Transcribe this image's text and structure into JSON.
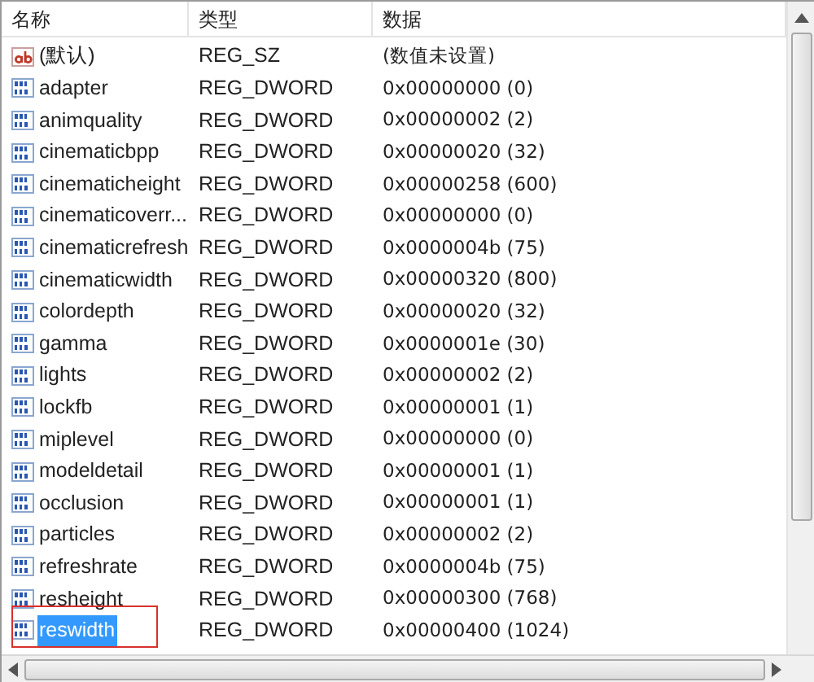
{
  "columns": [
    "名称",
    "类型",
    "数据"
  ],
  "rows": [
    {
      "kind": "string",
      "name": "(默认)",
      "type": "REG_SZ",
      "data": "(数值未设置)",
      "selected": false,
      "circled": false
    },
    {
      "kind": "dword",
      "name": "adapter",
      "type": "REG_DWORD",
      "data": "0x00000000 (0)",
      "selected": false,
      "circled": false
    },
    {
      "kind": "dword",
      "name": "animquality",
      "type": "REG_DWORD",
      "data": "0x00000002 (2)",
      "selected": false,
      "circled": false
    },
    {
      "kind": "dword",
      "name": "cinematicbpp",
      "type": "REG_DWORD",
      "data": "0x00000020 (32)",
      "selected": false,
      "circled": false
    },
    {
      "kind": "dword",
      "name": "cinematicheight",
      "type": "REG_DWORD",
      "data": "0x00000258 (600)",
      "selected": false,
      "circled": false
    },
    {
      "kind": "dword",
      "name": "cinematicoverr...",
      "type": "REG_DWORD",
      "data": "0x00000000 (0)",
      "selected": false,
      "circled": false
    },
    {
      "kind": "dword",
      "name": "cinematicrefresh",
      "type": "REG_DWORD",
      "data": "0x0000004b (75)",
      "selected": false,
      "circled": false
    },
    {
      "kind": "dword",
      "name": "cinematicwidth",
      "type": "REG_DWORD",
      "data": "0x00000320 (800)",
      "selected": false,
      "circled": false
    },
    {
      "kind": "dword",
      "name": "colordepth",
      "type": "REG_DWORD",
      "data": "0x00000020 (32)",
      "selected": false,
      "circled": false
    },
    {
      "kind": "dword",
      "name": "gamma",
      "type": "REG_DWORD",
      "data": "0x0000001e (30)",
      "selected": false,
      "circled": false
    },
    {
      "kind": "dword",
      "name": "lights",
      "type": "REG_DWORD",
      "data": "0x00000002 (2)",
      "selected": false,
      "circled": false
    },
    {
      "kind": "dword",
      "name": "lockfb",
      "type": "REG_DWORD",
      "data": "0x00000001 (1)",
      "selected": false,
      "circled": false
    },
    {
      "kind": "dword",
      "name": "miplevel",
      "type": "REG_DWORD",
      "data": "0x00000000 (0)",
      "selected": false,
      "circled": false
    },
    {
      "kind": "dword",
      "name": "modeldetail",
      "type": "REG_DWORD",
      "data": "0x00000001 (1)",
      "selected": false,
      "circled": false
    },
    {
      "kind": "dword",
      "name": "occlusion",
      "type": "REG_DWORD",
      "data": "0x00000001 (1)",
      "selected": false,
      "circled": false
    },
    {
      "kind": "dword",
      "name": "particles",
      "type": "REG_DWORD",
      "data": "0x00000002 (2)",
      "selected": false,
      "circled": false
    },
    {
      "kind": "dword",
      "name": "refreshrate",
      "type": "REG_DWORD",
      "data": "0x0000004b (75)",
      "selected": false,
      "circled": false
    },
    {
      "kind": "dword",
      "name": "resheight",
      "type": "REG_DWORD",
      "data": "0x00000300 (768)",
      "selected": false,
      "circled": false
    },
    {
      "kind": "dword",
      "name": "reswidth",
      "type": "REG_DWORD",
      "data": "0x00000400 (1024)",
      "selected": true,
      "circled": true
    }
  ]
}
